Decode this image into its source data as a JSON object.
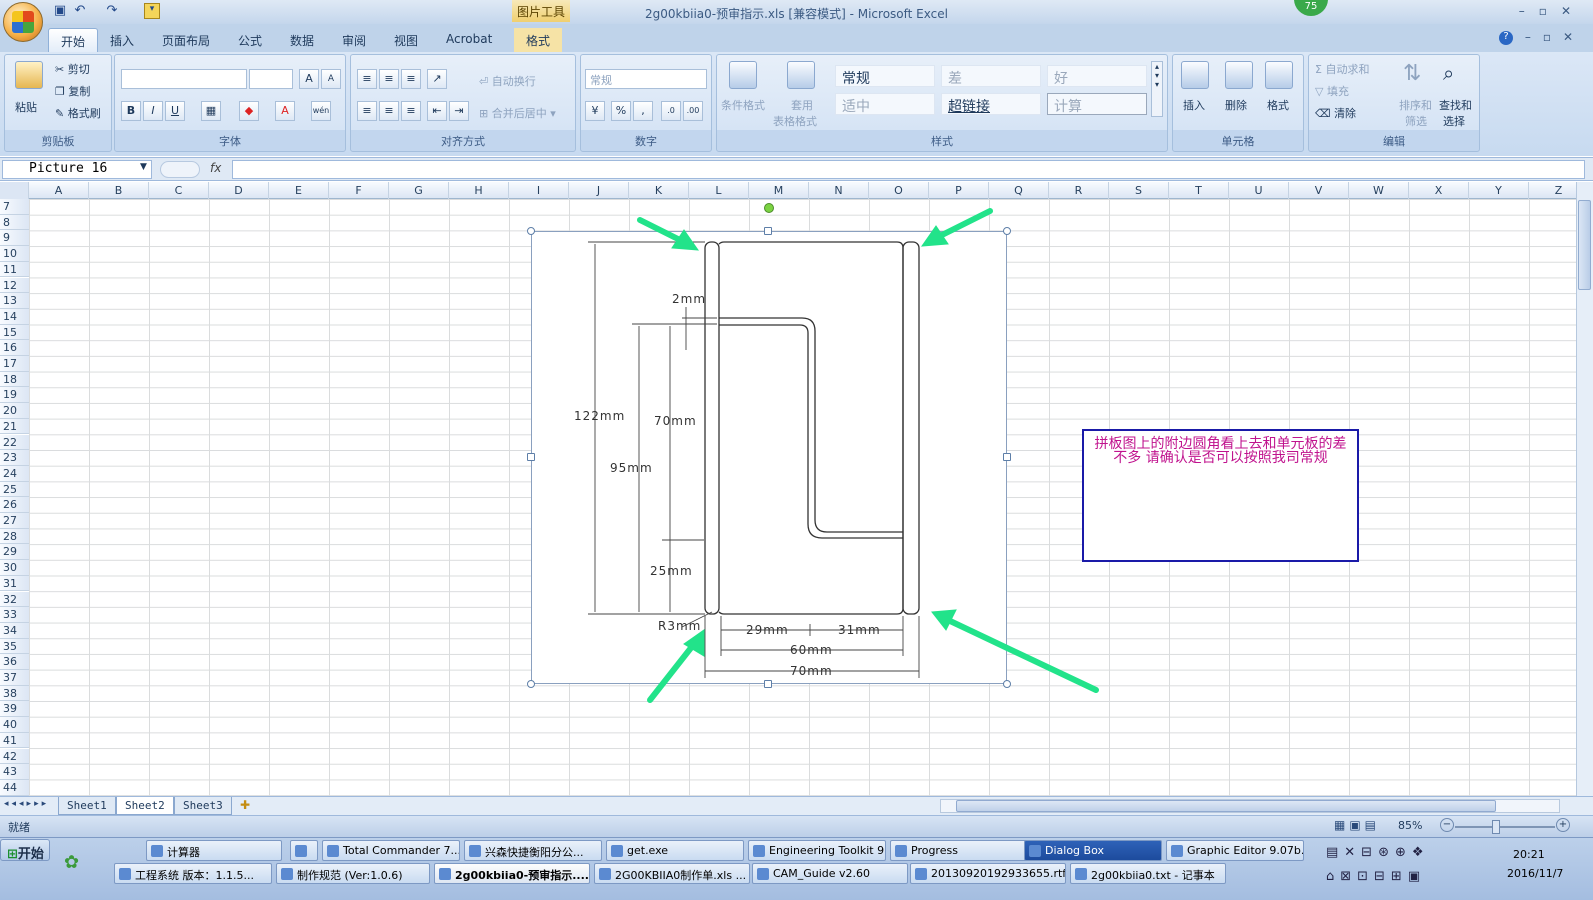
{
  "window": {
    "title": "2g00kbiia0-预审指示.xls  [兼容模式] - Microsoft Excel",
    "contextual_tab_group": "图片工具",
    "badge_count": "75"
  },
  "tabs": [
    "开始",
    "插入",
    "页面布局",
    "公式",
    "数据",
    "审阅",
    "视图",
    "Acrobat",
    "格式"
  ],
  "ribbon": {
    "clipboard": {
      "label": "剪贴板",
      "paste": "粘贴",
      "cut": "剪切",
      "copy": "复制",
      "format_painter": "格式刷"
    },
    "font": {
      "label": "字体",
      "bold": "B",
      "italic": "I",
      "underline": "U",
      "grow": "A",
      "shrink": "A"
    },
    "alignment": {
      "label": "对齐方式",
      "wrap": "自动换行",
      "merge": "合并后居中"
    },
    "number": {
      "label": "数字",
      "format": "常规",
      "percent": "%",
      "comma": ","
    },
    "styles": {
      "label": "样式",
      "cond_format": "条件格式",
      "table_format_1": "套用",
      "table_format_2": "表格格式",
      "cells": [
        "常规",
        "差",
        "好",
        "适中",
        "超链接",
        "计算"
      ]
    },
    "cells": {
      "label": "单元格",
      "insert": "插入",
      "delete": "删除",
      "format": "格式"
    },
    "editing": {
      "label": "编辑",
      "autosum": "自动求和",
      "fill": "填充",
      "clear": "清除",
      "sort_1": "排序和",
      "sort_2": "筛选",
      "find_1": "查找和",
      "find_2": "选择"
    }
  },
  "formula_bar": {
    "name_box": "Picture 16",
    "fx": "fx",
    "value": ""
  },
  "columns": [
    "A",
    "B",
    "C",
    "D",
    "E",
    "F",
    "G",
    "H",
    "I",
    "J",
    "K",
    "L",
    "M",
    "N",
    "O",
    "P",
    "Q",
    "R",
    "S",
    "T",
    "U",
    "V",
    "W",
    "X",
    "Y",
    "Z"
  ],
  "rows": [
    "7",
    "8",
    "9",
    "10",
    "11",
    "12",
    "13",
    "14",
    "15",
    "16",
    "17",
    "18",
    "19",
    "20",
    "21",
    "22",
    "23",
    "24",
    "25",
    "26",
    "27",
    "28",
    "29",
    "30",
    "31",
    "32",
    "33",
    "34",
    "35",
    "36",
    "37",
    "38",
    "39",
    "40",
    "41",
    "42",
    "43",
    "44"
  ],
  "drawing": {
    "labels": {
      "d2": "2mm",
      "d122": "122mm",
      "d70v": "70mm",
      "d95": "95mm",
      "d25": "25mm",
      "r3": "R3mm",
      "d29": "29mm",
      "d31": "31mm",
      "d60": "60mm",
      "d70h": "70mm"
    }
  },
  "comment_box": {
    "text": "拼板图上的附边圆角看上去和单元板的差不多   请确认是否可以按照我司常规"
  },
  "sheets": [
    "Sheet1",
    "Sheet2",
    "Sheet3"
  ],
  "active_sheet": "Sheet2",
  "status": {
    "ready": "就绪",
    "zoom": "85%"
  },
  "taskbar": {
    "start": "开始",
    "row1": [
      "计算器",
      "",
      "Total Commander 7....",
      "兴森快捷衡阳分公...",
      "get.exe",
      "Engineering Toolkit 9...",
      "Progress",
      "Dialog Box",
      "Graphic Editor 9.07b..."
    ],
    "row2": [
      "工程系统  版本：1.1.5...",
      "制作规范 (Ver:1.0.6)",
      "2g00kbiia0-预审指示....",
      "2G00KBIIA0制作单.xls ...",
      "CAM_Guide v2.60",
      "20130920192933655.rtf...",
      "2g00kbiia0.txt - 记事本"
    ],
    "time": "20:21",
    "date": "2016/11/7"
  },
  "colors": {
    "arrow": "#22e38a",
    "comment_border": "#1a1aa8",
    "comment_text": "#c0138e"
  }
}
